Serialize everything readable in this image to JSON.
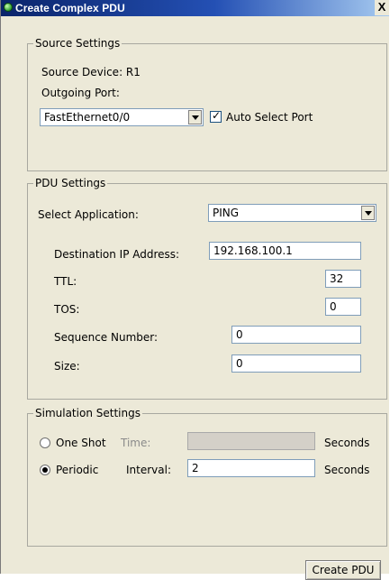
{
  "window": {
    "title": "Create Complex PDU",
    "close_glyph": "X"
  },
  "source_settings": {
    "legend": "Source Settings",
    "source_device": "Source Device: R1",
    "outgoing_port_label": "Outgoing Port:",
    "port_value": "FastEthernet0/0",
    "auto_select_label": "Auto Select Port",
    "auto_select_checked": true
  },
  "pdu_settings": {
    "legend": "PDU Settings",
    "select_app_label": "Select Application:",
    "app_value": "PING",
    "dest_ip_label": "Destination IP Address:",
    "dest_ip_value": "192.168.100.1",
    "ttl_label": "TTL:",
    "ttl_value": "32",
    "tos_label": "TOS:",
    "tos_value": "0",
    "seq_label": "Sequence Number:",
    "seq_value": "0",
    "size_label": "Size:",
    "size_value": "0"
  },
  "simulation_settings": {
    "legend": "Simulation Settings",
    "one_shot_label": "One Shot",
    "time_label": "Time:",
    "time_value": "",
    "seconds_label_1": "Seconds",
    "periodic_label": "Periodic",
    "interval_label": "Interval:",
    "interval_value": "2",
    "seconds_label_2": "Seconds",
    "selected_mode": "Periodic"
  },
  "actions": {
    "create_pdu_label": "Create PDU"
  },
  "icons": {
    "app": "packet-tracer-icon",
    "dropdown": "chevron-down-icon",
    "check": "checkmark-icon"
  },
  "colors": {
    "titlebar_start": "#0a246a",
    "titlebar_end": "#a6caf0",
    "window_bg": "#ece9d8"
  }
}
